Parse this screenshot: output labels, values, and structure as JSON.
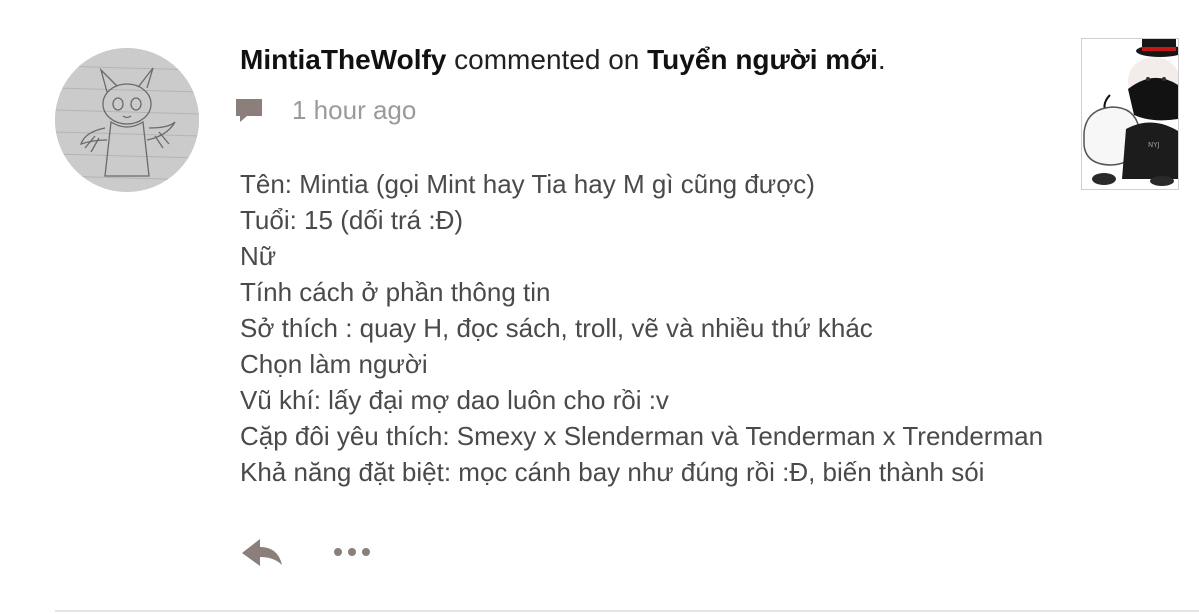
{
  "notification": {
    "author": "MintiaTheWolfy",
    "action_text": "commented on",
    "target": "Tuyển người mới",
    "end_punct": ".",
    "time": "1 hour ago",
    "icons": {
      "meta": "chat-bubble-icon",
      "reply": "reply-arrow-icon",
      "more": "more-dots-icon"
    },
    "body_lines": [
      "Tên: Mintia (gọi Mint hay Tia hay M gì cũng được)",
      "Tuổi: 15 (dối trá :Đ)",
      "Nữ",
      "Tính cách ở phần thông tin",
      "Sở thích : quay H, đọc sách, troll, vẽ và nhiều thứ khác",
      "Chọn làm người",
      "Vũ khí: lấy đại mợ dao luôn cho rồi :v",
      "Cặp đôi yêu thích: Smexy x Slenderman và Tenderman x Trenderman",
      "Khả năng đặt biệt: mọc cánh bay như đúng rồi :Đ, biến thành sói"
    ]
  },
  "colors": {
    "title_text": "#111111",
    "body_text": "#4a4a4a",
    "muted": "#9a9a9a",
    "icon": "#8a7f7a"
  }
}
